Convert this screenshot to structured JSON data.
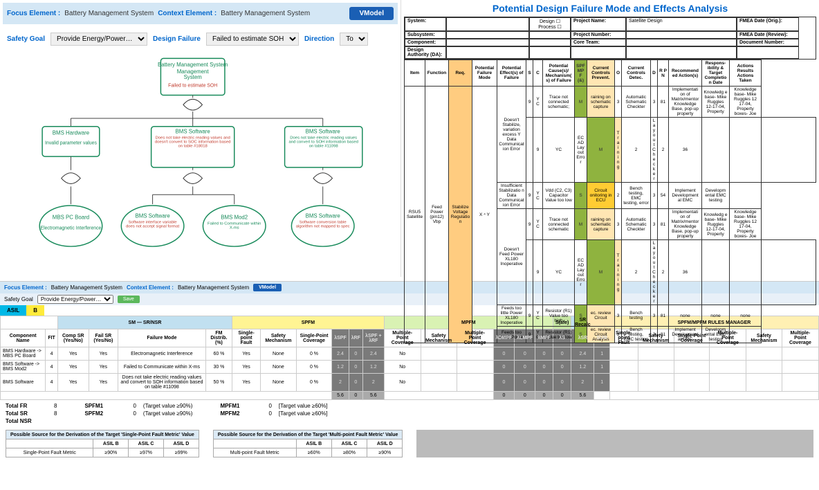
{
  "top_bar": {
    "focus_label": "Focus Element :",
    "focus_value": "Battery Management System",
    "context_label": "Context Element :",
    "context_value": "Battery Management System",
    "vmodel": "VModel"
  },
  "filters": {
    "safety_goal_label": "Safety Goal",
    "safety_goal_value": "Provide Energy/Power…",
    "design_failure_label": "Design Failure",
    "design_failure_value": "Failed to estimate SOH",
    "direction_label": "Direction",
    "direction_value": "To"
  },
  "tree": {
    "root": {
      "title": "Battery Management System",
      "failure": "Failed to estimate SOH"
    },
    "level1": [
      {
        "title": "BMS Hardware",
        "failure": "Invalid parameter values",
        "color": "#178a5a"
      },
      {
        "title": "BMS Software",
        "failure": "Does not take electric reading values and doesn't convert to SOC information based on table #18018",
        "color": "#178a5a"
      },
      {
        "title": "BMS Software",
        "failure": "Does not take electric reading values and convert to SOH information based on table #11098",
        "color": "#178a5a"
      }
    ],
    "level2": [
      {
        "title": "MBS PC Board",
        "failure": "Electromagnetic Interference",
        "color": "#178a5a"
      },
      {
        "title": "BMS Software",
        "failure": "Software interface variable does not accept signal format",
        "color": "#c0392b"
      },
      {
        "title": "BMS Mod2",
        "failure": "Failed to Communicate within X-ms",
        "color": "#178a5a"
      },
      {
        "title": "BMS Software",
        "failure": "Software conversion table algorithm not mapped to spec",
        "color": "#c0392b"
      }
    ]
  },
  "fmea": {
    "title": "Potential Design Failure Mode and Effects Analysis",
    "hdr": {
      "system": "System:",
      "subsystem": "Subsystem:",
      "component": "Component:",
      "da": "Design Authority (DA):",
      "design": "Design",
      "process": "Process",
      "proj_name": "Project Name:",
      "proj_name_val": "Satellite Design",
      "proj_num": "Project Number:",
      "core_team": "Core Team:",
      "fmea_date_orig": "FMEA Date (Orig.):",
      "fmea_date_rev": "FMEA Date (Review):",
      "doc_num": "Document Number:"
    },
    "cols": {
      "item": "Item",
      "function": "Function",
      "req": "Req.",
      "pfm": "Potential Failure Mode",
      "peof": "Potential Effect(s) of Failure",
      "s": "S",
      "c": "C",
      "pcm": "Potential Cause(s)/ Mechanism(s) of Failure",
      "spf": "SPF MPF (&)",
      "ccp": "Current Controls Prevent.",
      "o": "O",
      "ccd": "Current Controls Detec.",
      "d": "D",
      "rpn": "R P N",
      "ra": "Recommend ed Action(s)",
      "resp": "Respons- ibility & Target Completio n Date",
      "ar": "Actions Results",
      "at": "Actions Taken"
    },
    "rows": [
      {
        "item": "RSU5 Satellite",
        "function": "Feed Power (pin12) Vbp",
        "subrows": [
          {
            "req": "Stabilize Voltage Regulation",
            "pfm": "X ⁴ Y",
            "peof_group": [
              {
                "peof": "Doesn't Stabilize, variation excess Y",
                "sub": [
                  {
                    "effect": "Data Communicat ion Error",
                    "s": "9",
                    "c": "YC",
                    "cause": "Trace not connected schematic;",
                    "spf": "M",
                    "ccp": "raining on schematic capture",
                    "o": "3",
                    "ccd": "Automatic Schematic Checkter",
                    "d": "3",
                    "rpn": "81",
                    "ra": "Implementati on of Matrix/mentor Knowledge Base, pop-up property",
                    "resp": "Knowledg e base- Mike Ruggles 12-17-04, Property",
                    "at": "Knowledge base- Mike Ruggles 12 17-04, Property boxes- Joe"
                  },
                  {
                    "effect": "",
                    "s": "9",
                    "c": "YC",
                    "cause": "ECAD Layout Error",
                    "spf": "M",
                    "ccp": "Training",
                    "o": "2",
                    "ccd": "Layout Checker",
                    "d": "2",
                    "rpn": "36",
                    "ra": "",
                    "resp": "",
                    "at": ""
                  }
                ]
              },
              {
                "peof": "Insufficient Stabilizatio n",
                "sub": [
                  {
                    "effect": "Data Communicat ion Error",
                    "s": "9",
                    "c": "YC",
                    "cause": "Vdd (C2, C3) Capacitor Value too low",
                    "spf": "S",
                    "ccp": "Circuit onitoring in ECU",
                    "circuit": true,
                    "o": "2",
                    "ccd": "Bench testing, EMC testing, error",
                    "d": "3",
                    "rpn": "54",
                    "ra": "Implement Development al EMC",
                    "resp": "Developm ental EMC testing",
                    "at": ""
                  }
                ]
              },
              {
                "peof": "Doesn't Feed Power",
                "sub": [
                  {
                    "effect": "XL180 Inoperative",
                    "s": "9",
                    "c": "YC",
                    "cause": "Trace not connected schematic",
                    "spf": "M",
                    "ccp": "raining on schematic capture",
                    "o": "3",
                    "ccd": "Automatic Schematic Checkter",
                    "d": "3",
                    "rpn": "81",
                    "ra": "Implementati on of Matrix/mentor Knowledge Base, pop-up property",
                    "resp": "Knowledg e base- Mike Ruggles 12-17-04, Property",
                    "at": "Knowledge base- Mike Ruggles 12 17-04, Property boxes- Joe"
                  },
                  {
                    "effect": "",
                    "s": "9",
                    "c": "YC",
                    "cause": "ECAD Layout Error",
                    "spf": "M",
                    "ccp": "Training",
                    "o": "2",
                    "ccd": "Layout Checker",
                    "d": "2",
                    "rpn": "36",
                    "ra": "",
                    "resp": "",
                    "at": ""
                  }
                ]
              },
              {
                "peof": "Feeds too little Power",
                "sub": [
                  {
                    "effect": "XL180 Inoperative",
                    "s": "9",
                    "c": "YC",
                    "cause": "Resistor (R1) Value too high",
                    "spf": "S",
                    "ccp": "ec. review Circuit",
                    "o": "3",
                    "ccd": "Bench testing",
                    "d": "3",
                    "rpn": "81",
                    "ra": "none",
                    "resp": "none",
                    "at": "none"
                  }
                ]
              },
              {
                "peof": "Feeds too much Power",
                "sub": [
                  {
                    "effect": "",
                    "s": "9",
                    "c": "YC",
                    "cause": "Resistor (R1) Value too low",
                    "spf": "S",
                    "ccp": "ec. review Circuit Analysis",
                    "o": "3",
                    "ccd": "Bench testing, EMC testing",
                    "d": "3",
                    "rpn": "81",
                    "ra": "Implement Development al EMC",
                    "resp": "Developm ental EMC testing",
                    "at": ""
                  }
                ]
              }
            ]
          }
        ]
      }
    ]
  },
  "bottom_bar": {
    "focus_label": "Focus Element :",
    "focus_value": "Battery Management System",
    "context_label": "Context Element :",
    "context_value": "Battery Management System",
    "vmodel": "VModel",
    "sg_label": "Safety Goal",
    "sg_value": "Provide Energy/Power…",
    "save": "Save"
  },
  "asil": {
    "label": "ASIL",
    "value": "B"
  },
  "metric_headers": {
    "sr": "SM — SR/NSR",
    "spfm": "SPFM",
    "mpfm": "MPFM",
    "safe": "S(afe)",
    "srrecalc": "SR Recalc",
    "rules": "SPFM/MPFM RULES MANAGER"
  },
  "metric_cols": {
    "comp": "Component Name",
    "fit": "FIT",
    "csr": "Comp SR (Yes/No)",
    "fsr": "Fail SR (Yes/No)",
    "fm": "Failure Mode",
    "fmd": "FM Distrib. (%)",
    "spf": "Single-point Fault",
    "sm": "Safety Mechanism",
    "spc": "Single-Point Coverage",
    "aspf": "λSPF",
    "arf": "λRF",
    "aspfarf": "λSPF + λRF",
    "mpc": "Multiple-Point Coverage",
    "sm2": "Safety Mechanism",
    "mpcov": "Multiple-Point Coverage",
    "admpf": "λDMPF",
    "almpf": "λLMPF",
    "ampf": "λMPF",
    "as": "λS",
    "asr": "λSR",
    "sum": "SUM",
    "r_spf": "Single-point Fault",
    "r_sm": "Safety Mechanism",
    "r_spc": "Single-Point Coverage",
    "r_mpc": "Multiple-Point Coverage",
    "r_sm2": "Safety Mechanism",
    "r_mpcov": "Multiple-Point Coverage"
  },
  "metric_rows": [
    {
      "comp": "BMS Hardware -> MBS PC Board",
      "fit": "4",
      "csr": "Yes",
      "fsr": "Yes",
      "fm": "Electromagnetic Interference",
      "fmd": "60 %",
      "spf": "Yes",
      "sm": "None",
      "spc": "0 %",
      "aspf": "2.4",
      "arf": "0",
      "aspfarf": "2.4",
      "mpc": "No",
      "admpf": "0",
      "almpf": "0",
      "ampf": "0",
      "as": "0",
      "asr": "2.4",
      "sum": "1"
    },
    {
      "comp": "BMS Software -> BMS Mod2",
      "fit": "4",
      "csr": "Yes",
      "fsr": "Yes",
      "fm": "Failed to Communicate within X-ms",
      "fmd": "30 %",
      "spf": "Yes",
      "sm": "None",
      "spc": "0 %",
      "aspf": "1.2",
      "arf": "0",
      "aspfarf": "1.2",
      "mpc": "No",
      "admpf": "0",
      "almpf": "0",
      "ampf": "0",
      "as": "0",
      "asr": "1.2",
      "sum": "1"
    },
    {
      "comp": "BMS Software",
      "fit": "4",
      "csr": "Yes",
      "fsr": "Yes",
      "fm": "Does not take electric reading values and convert to SOH information based on table #11098",
      "fmd": "50 %",
      "spf": "Yes",
      "sm": "None",
      "spc": "0 %",
      "aspf": "2",
      "arf": "0",
      "aspfarf": "2",
      "mpc": "No",
      "admpf": "0",
      "almpf": "0",
      "ampf": "0",
      "as": "0",
      "asr": "2",
      "sum": "1"
    }
  ],
  "metric_totals": {
    "aspf": "5.6",
    "arf": "0",
    "aspfarf": "5.6",
    "admpf": "0",
    "almpf": "0",
    "ampf": "0",
    "as": "0",
    "asr": "5.6"
  },
  "totals": {
    "fr_label": "Total FR",
    "fr": "8",
    "sr_label": "Total SR",
    "sr": "8",
    "nsr_label": "Total NSR",
    "nsr": "",
    "spfm1_label": "SPFM1",
    "spfm1": "0",
    "spfm1_tgt": "(Target value ≥90%)",
    "spfm2_label": "SPFM2",
    "spfm2": "0",
    "spfm2_tgt": "(Target value ≥90%)",
    "mpfm1_label": "MPFM1",
    "mpfm1": "0",
    "mpfm1_tgt": "[Target value ≥60%]",
    "mpfm2_label": "MPFM2",
    "mpfm2": "0",
    "mpfm2_tgt": "[Target value ≥60%]"
  },
  "src1": {
    "title": "Possible Source for the Derivation of the Target 'Single-Point Fault Metric' Value",
    "h": [
      "",
      "ASIL B",
      "ASIL C",
      "ASIL D"
    ],
    "r": [
      "Single-Point Fault Metric",
      "≥90%",
      "≥97%",
      "≥99%"
    ]
  },
  "src2": {
    "title": "Possible Source for the Derivation of the Target 'Multi-point Fault Metric' Value",
    "h": [
      "",
      "ASIL B",
      "ASIL C",
      "ASIL D"
    ],
    "r": [
      "Multi-point Fault Metric",
      "≥60%",
      "≥80%",
      "≥90%"
    ]
  }
}
